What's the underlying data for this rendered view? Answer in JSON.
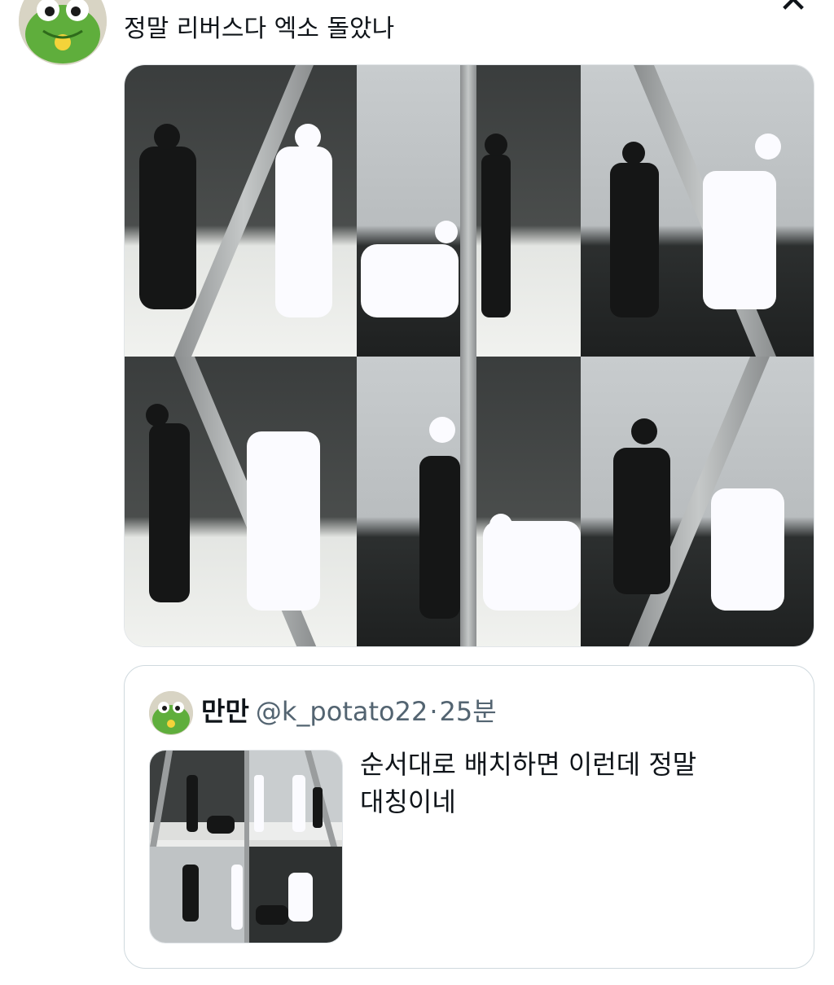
{
  "tweet": {
    "text": "정말 리버스다 엑소 돌았나",
    "close_glyph": "✕",
    "author_avatar_icon": "frog-avatar-icon",
    "media_alt": "grid-photo-icon"
  },
  "quote": {
    "name": "만만",
    "handle": "@k_potato22",
    "separator": "·",
    "time": "25분",
    "text": "순서대로 배치하면 이런데 정말 대칭이네",
    "avatar_icon": "frog-avatar-icon"
  },
  "colors": {
    "text": "#0f1419",
    "secondary": "#536471",
    "border": "#cfd9de",
    "frog_green": "#5fae3c"
  }
}
